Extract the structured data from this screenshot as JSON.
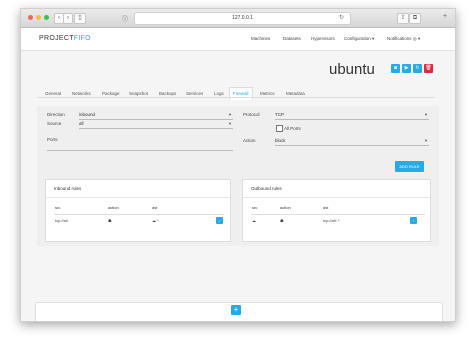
{
  "browser": {
    "url": "127.0.0.1"
  },
  "header": {
    "logo_part1": "PROJECT",
    "logo_part2": "FIFO",
    "nav": [
      "Machines",
      "Datasets",
      "Hypervisors",
      "Configuration ▾",
      "Notifications ◎ ▾"
    ]
  },
  "page": {
    "title": "ubuntu"
  },
  "actions": [
    {
      "name": "stop-icon",
      "glyph": "■",
      "color": "#29abe2"
    },
    {
      "name": "play-icon",
      "glyph": "▶",
      "color": "#29abe2"
    },
    {
      "name": "refresh-icon",
      "glyph": "↻",
      "color": "#29abe2"
    },
    {
      "name": "trash-icon",
      "glyph": "🗑",
      "color": "#e02a3d"
    }
  ],
  "tabs": [
    "General",
    "Networks",
    "Package",
    "Snapshot",
    "Backups",
    "Services",
    "Logs",
    "Firewall",
    "Metrics",
    "Metadata"
  ],
  "active_tab": "Firewall",
  "form": {
    "direction_label": "Direction",
    "direction_value": "inbound",
    "source_label": "Source",
    "source_value": "all",
    "ports_label": "Ports",
    "ports_value": "",
    "protocol_label": "Protocol",
    "protocol_value": "TCP",
    "all_ports_label": "All Ports",
    "action_label": "Action",
    "action_value": "block",
    "add_rule": "ADD RULE"
  },
  "inbound": {
    "title": "Inbound rules",
    "headers": [
      "src",
      "action",
      "dst"
    ],
    "row": {
      "src": "tcp://all",
      "action_icon": "☗",
      "dst": "☁ *"
    }
  },
  "outbound": {
    "title": "Outbound rules",
    "headers": [
      "src",
      "action",
      "dst"
    ],
    "row": {
      "src": "☁",
      "action_icon": "☗",
      "dst": "tcp://all: *"
    }
  },
  "bottom": {
    "add": "+"
  }
}
